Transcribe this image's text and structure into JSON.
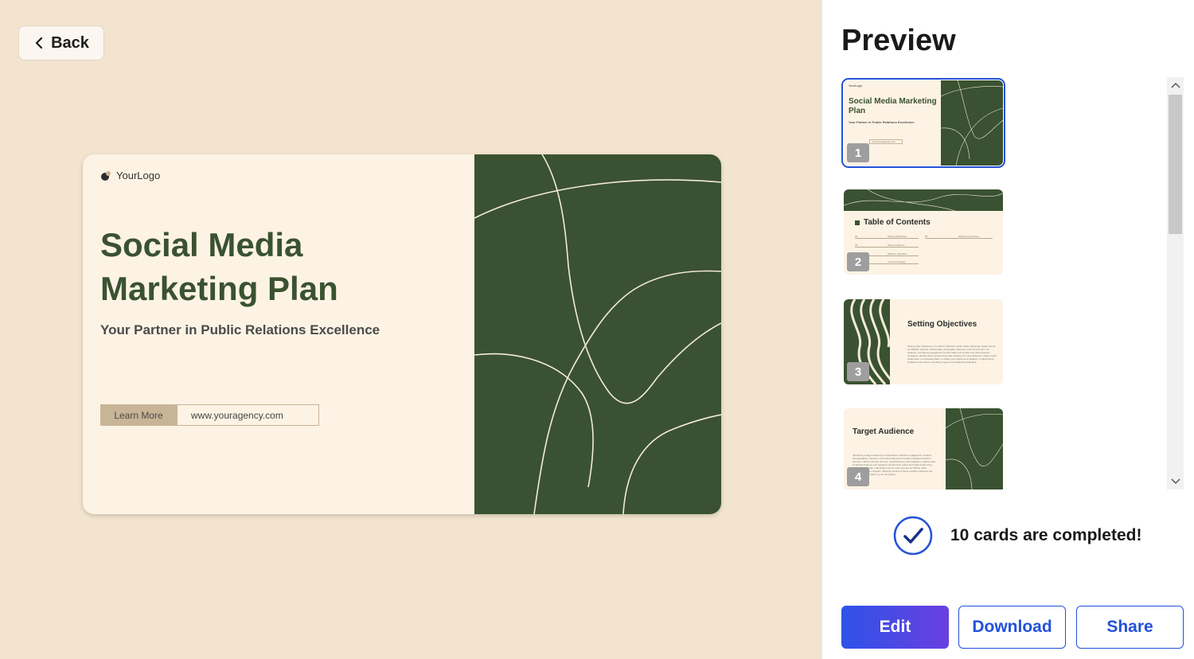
{
  "back_label": "Back",
  "slide": {
    "logo": "YourLogo",
    "title": "Social Media Marketing Plan",
    "subtitle": "Your Partner in Public Relations Excellence",
    "cta_label": "Learn More",
    "cta_url": "www.youragency.com"
  },
  "preview": {
    "title": "Preview",
    "thumbnails": [
      {
        "number": "1",
        "title": "Social Media Marketing Plan",
        "subtitle": "Your Partner in Public Relations Excellence",
        "url": "www.youragency.com",
        "logo": "YourLogo"
      },
      {
        "number": "2",
        "title": "Table of Contents",
        "items": [
          "01",
          "Setting Objectives",
          "05",
          "Measuring Success",
          "02",
          "Target Audience",
          "03",
          "Platform Selection",
          "04",
          "Content Strategy"
        ]
      },
      {
        "number": "3",
        "title": "Setting Objectives",
        "body": "Setting clear objectives is crucial for effective social media marketing. Goals should be SMART: Specific, Measurable, Achievable, Relevant, and Time-bound. For instance, increasing engagement by 20% within six months can drive focused strategies. Identify what success looks like, whether it's more followers, higher brand awareness, or increased sales, to shape your tactics and initiatives. Implementing analytics tools helps in tracking progress and adjusting strategies."
      },
      {
        "number": "4",
        "title": "Target Audience",
        "body": "Identifying a target audience is essential for effective engagement. Analyze demographics, interests, and online behaviors to build a detailed customer persona. Utilize tools like surveys, social listening, and analytics to gather data. Understand where your audience spends time online and what content they prefer. For example, millennials may be more present on TikTok, while professionals use LinkedIn. Tailoring content to these insights enhances the relevance and impact of your campaigns."
      }
    ]
  },
  "status_text": "10 cards are completed!",
  "actions": {
    "edit": "Edit",
    "download": "Download",
    "share": "Share"
  },
  "colors": {
    "accent": "#2451d9",
    "slide_green": "#3a5232",
    "slide_cream": "#fdf3e4",
    "background": "#f2e4cf"
  }
}
